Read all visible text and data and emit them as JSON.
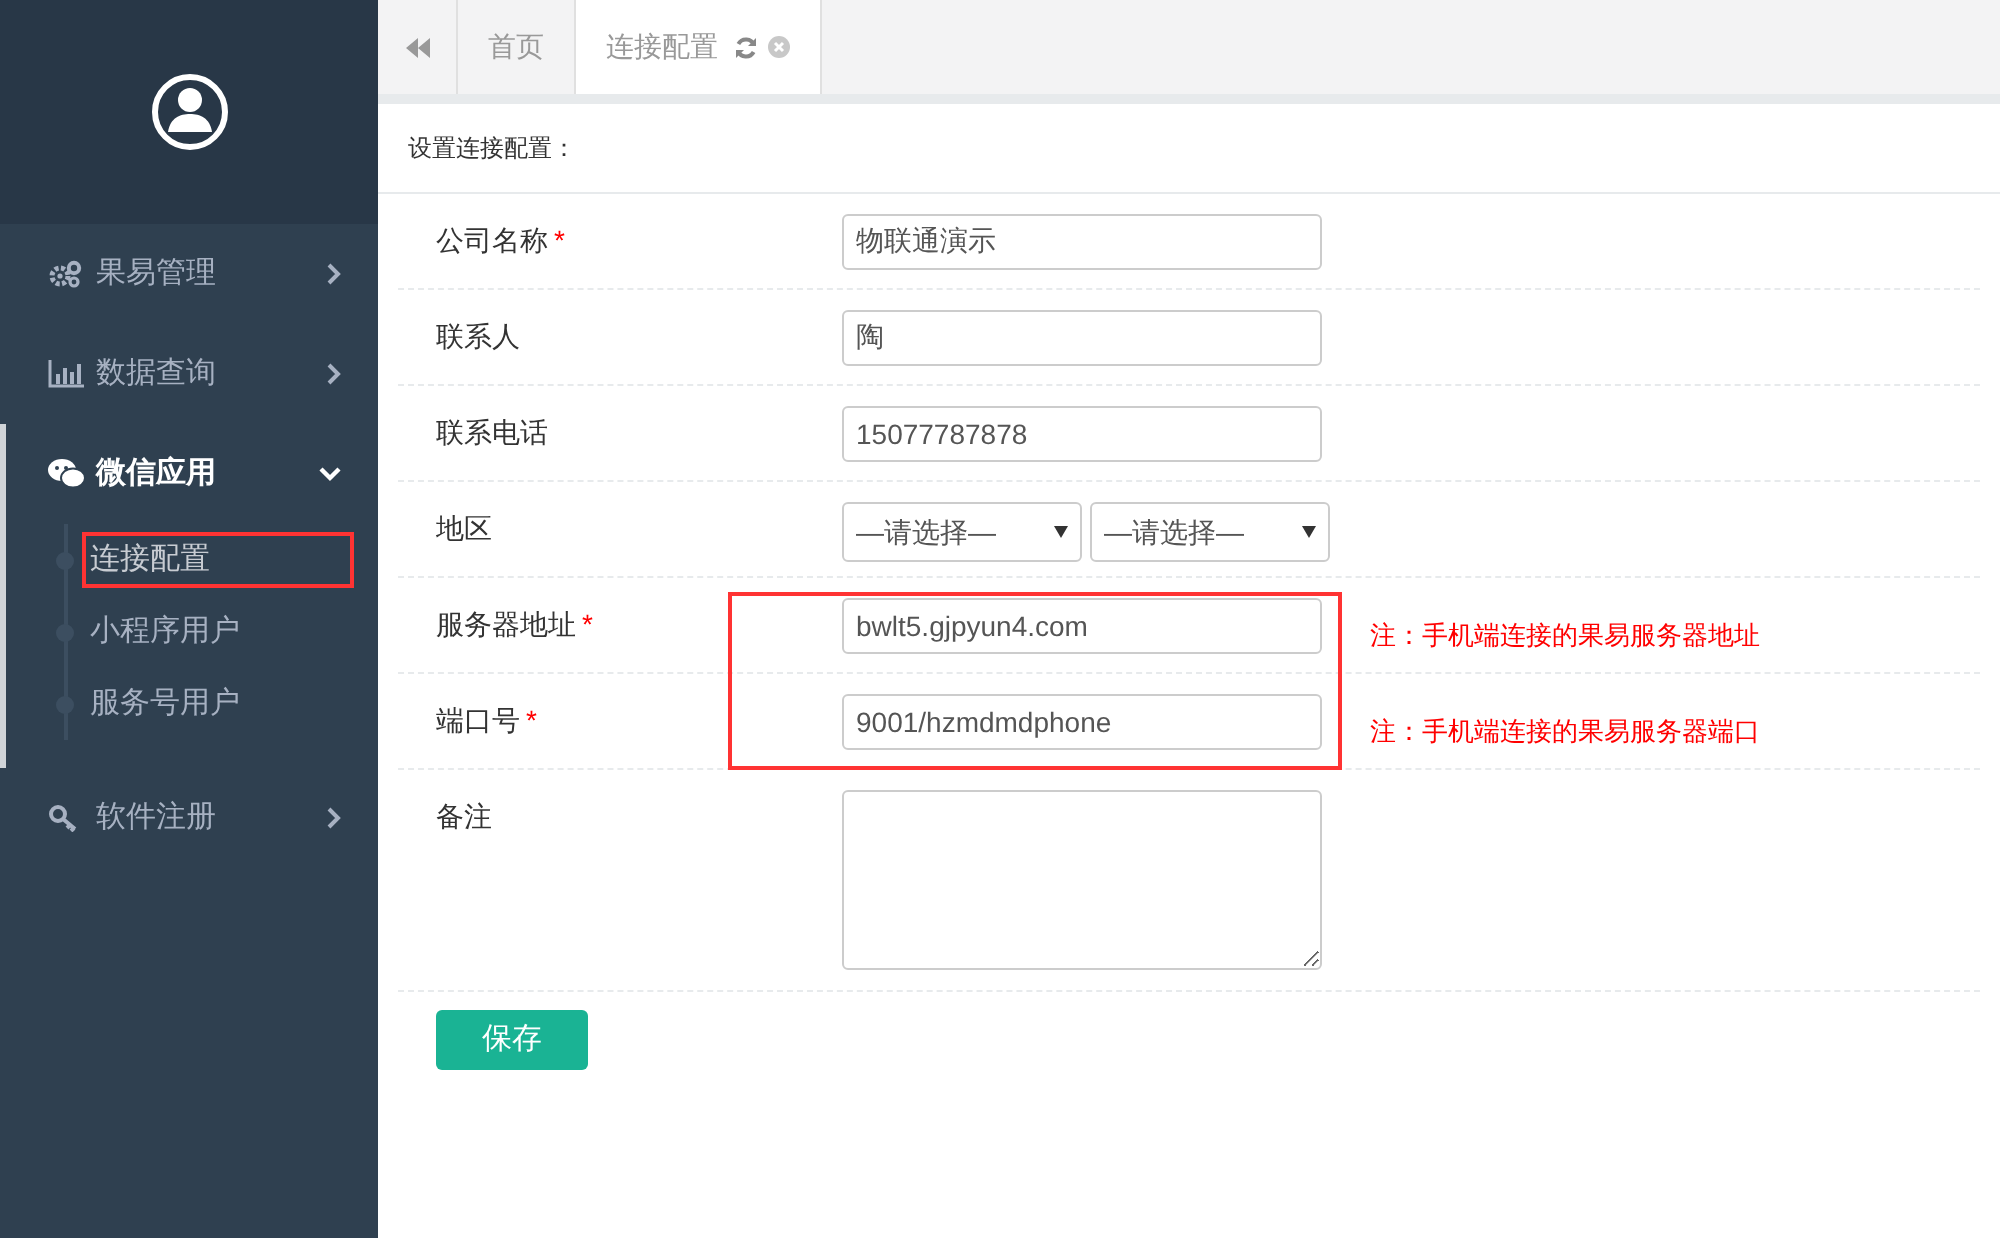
{
  "sidebar": {
    "items": [
      {
        "label": "果易管理",
        "expanded": false
      },
      {
        "label": "数据查询",
        "expanded": false
      },
      {
        "label": "微信应用",
        "expanded": true,
        "children": [
          {
            "label": "连接配置",
            "selected": true,
            "highlighted": true
          },
          {
            "label": "小程序用户",
            "selected": false,
            "highlighted": false
          },
          {
            "label": "服务号用户",
            "selected": false,
            "highlighted": false
          }
        ]
      },
      {
        "label": "软件注册",
        "expanded": false
      }
    ]
  },
  "tabs": [
    {
      "label": "首页",
      "selected": false,
      "closable": false
    },
    {
      "label": "连接配置",
      "selected": true,
      "closable": true
    }
  ],
  "form": {
    "title": "设置连接配置：",
    "rows": [
      {
        "kind": "input",
        "label": "公司名称",
        "required_mark": "*",
        "value": "物联通演示",
        "highlighted": false
      },
      {
        "kind": "input",
        "label": "联系人",
        "value": "陶",
        "highlighted": false
      },
      {
        "kind": "input",
        "label": "联系电话",
        "value": "15077787878",
        "highlighted": false
      },
      {
        "kind": "selects",
        "label": "地区",
        "selects": [
          "—请选择—",
          "—请选择—"
        ],
        "highlighted": false
      },
      {
        "kind": "input",
        "label": "服务器地址",
        "required_mark": "*",
        "value": "bwlt5.gjpyun4.com",
        "note": "注：手机端连接的果易服务器地址",
        "highlighted": true
      },
      {
        "kind": "input",
        "label": "端口号",
        "required_mark": "*",
        "value": "9001/hzmdmdphone",
        "note": "注：手机端连接的果易服务器端口",
        "highlighted": true
      },
      {
        "kind": "textarea",
        "label": "备注",
        "value": "",
        "highlighted": false
      }
    ],
    "save_button": "保存"
  }
}
